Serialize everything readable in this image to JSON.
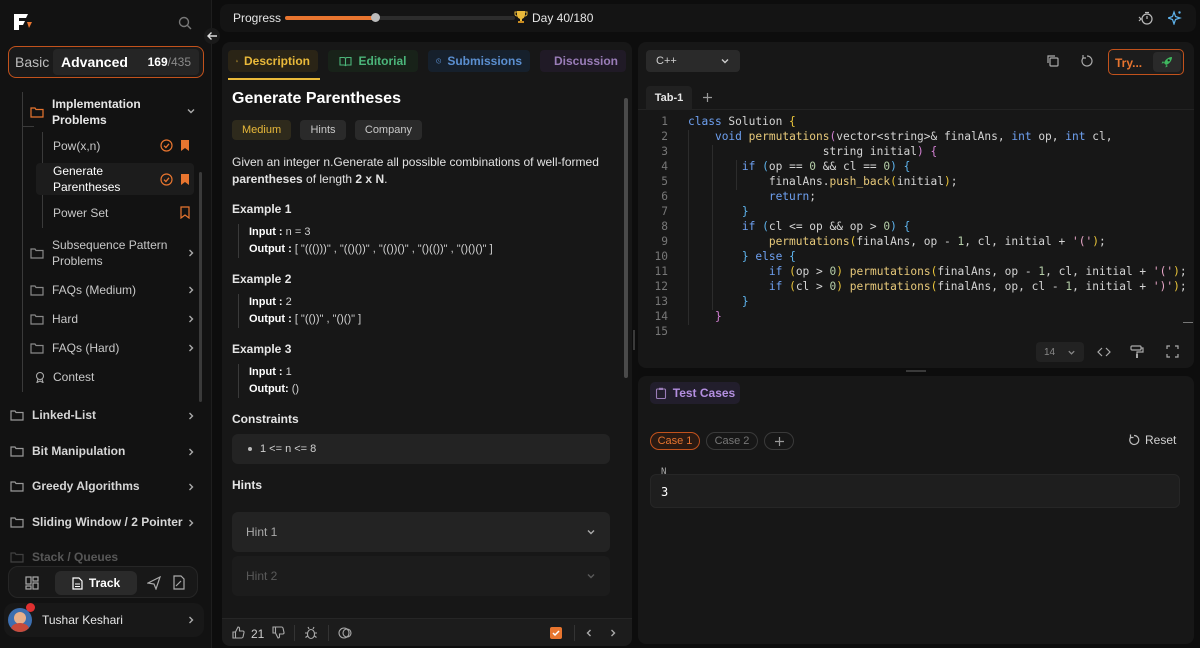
{
  "sidebar": {
    "mode_basic": "Basic",
    "mode_advanced": "Advanced",
    "count_done": "169",
    "count_total": "/435",
    "items": [
      {
        "label": "Implementation Problems"
      },
      {
        "label": "Pow(x,n)"
      },
      {
        "label": "Generate Parentheses"
      },
      {
        "label": "Power Set"
      },
      {
        "label": "Subsequence Pattern Problems"
      },
      {
        "label": "FAQs (Medium)"
      },
      {
        "label": "Hard"
      },
      {
        "label": "FAQs (Hard)"
      },
      {
        "label": "Contest"
      }
    ],
    "sections": [
      {
        "label": "Linked-List"
      },
      {
        "label": "Bit Manipulation"
      },
      {
        "label": "Greedy Algorithms"
      },
      {
        "label": "Sliding Window / 2 Pointer"
      },
      {
        "label": "Stack / Queues"
      }
    ],
    "track_label": "Track",
    "user_name": "Tushar Keshari",
    "accent": "#e8752f"
  },
  "header": {
    "progress_label": "Progress",
    "progress_fraction": 0.39,
    "day_label": "Day 40/180"
  },
  "problem": {
    "tabs": [
      {
        "label": "Description"
      },
      {
        "label": "Editorial"
      },
      {
        "label": "Submissions"
      },
      {
        "label": "Discussion"
      }
    ],
    "title": "Generate Parentheses",
    "difficulty": "Medium",
    "hints_pill": "Hints",
    "company_pill": "Company",
    "desc_1": "Given an integer n.Generate all possible combinations of well-formed",
    "desc_bold_1": "parentheses",
    "desc_2": " of length ",
    "desc_bold_2": "2 x N",
    "desc_3": ".",
    "examples": [
      {
        "title": "Example 1",
        "input_label": "Input :",
        "input": " n = 3",
        "output_label": "Output :",
        "output": " [ \"((()))\" , \"(()())\" , \"(())()\" , \"()(())\" , \"()()()\" ]"
      },
      {
        "title": "Example 2",
        "input_label": "Input :",
        "input": " 2",
        "output_label": "Output :",
        "output": " [ \"(())\" , \"()()\" ]"
      },
      {
        "title": "Example 3",
        "input_label": "Input :",
        "input": " 1",
        "output_label": "Output:",
        "output": "  ()"
      }
    ],
    "constraints_title": "Constraints",
    "constraint": "1 <= n <= 8",
    "hints_title": "Hints",
    "hint_1": "Hint 1",
    "hint_2": "Hint 2",
    "likes": "21"
  },
  "editor": {
    "language": "C++",
    "try_label": "Try...",
    "tab_label": "Tab-1",
    "font_size": "14",
    "line_numbers": [
      "1",
      "2",
      "3",
      "4",
      "5",
      "6",
      "7",
      "8",
      "9",
      "10",
      "11",
      "12",
      "13",
      "14",
      "15"
    ]
  },
  "tests": {
    "title": "Test Cases",
    "case_1": "Case 1",
    "case_2": "Case 2",
    "reset_label": "Reset",
    "param_name": "N",
    "param_value": "3"
  }
}
